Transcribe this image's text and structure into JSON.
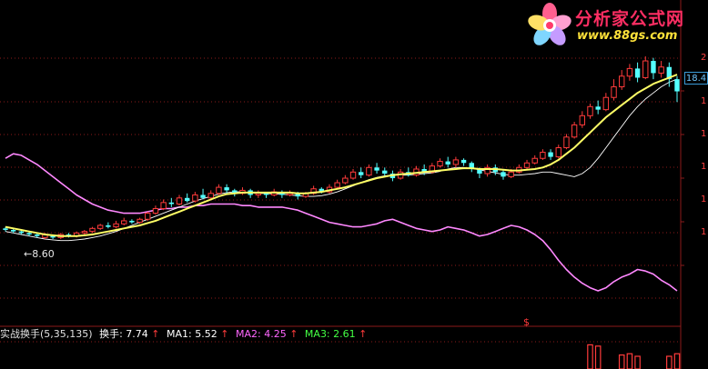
{
  "watermark": {
    "title": "分析家公式网",
    "url": "www.88gs.com"
  },
  "indicator": {
    "name": "实战换手(5,35,135)",
    "turnover_label": "换手:",
    "turnover_value": "7.74",
    "ma1_label": "MA1:",
    "ma1_value": "5.52",
    "ma2_label": "MA2:",
    "ma2_value": "4.25",
    "ma3_label": "MA3:",
    "ma3_value": "2.61",
    "arrow": "↑"
  },
  "price_tag": "18.4",
  "low_marker": "←8.60",
  "signal_marker": "$",
  "right_axis_ticks": [
    "2",
    "1",
    "1",
    "1",
    "1",
    "1"
  ],
  "colors": {
    "background": "#000000",
    "grid": "#8b1a1a",
    "up_candle": "#ff3b3b",
    "down_candle": "#54ffff",
    "ma_short": "#ffffff",
    "ma_mid": "#ffff66",
    "ma_pink": "#ff88ff",
    "ma2_text": "#ff66ff",
    "ma3_text": "#44ff44",
    "volume": "#ff3b3b"
  },
  "chart_data": {
    "type": "candlestick",
    "low_price": 8.6,
    "last_price_label": 18.4,
    "candles": [
      [
        9.6,
        9.5,
        9.7,
        9.4
      ],
      [
        9.5,
        9.4,
        9.6,
        9.3
      ],
      [
        9.4,
        9.3,
        9.5,
        9.2
      ],
      [
        9.3,
        9.2,
        9.4,
        9.1
      ],
      [
        9.2,
        9.1,
        9.3,
        9.0
      ],
      [
        9.0,
        9.2,
        9.3,
        8.9
      ],
      [
        9.1,
        9.0,
        9.2,
        8.9
      ],
      [
        9.0,
        9.2,
        9.3,
        8.9
      ],
      [
        9.2,
        9.1,
        9.3,
        9.0
      ],
      [
        9.1,
        9.3,
        9.4,
        9.0
      ],
      [
        9.3,
        9.4,
        9.5,
        9.2
      ],
      [
        9.4,
        9.6,
        9.7,
        9.3
      ],
      [
        9.6,
        9.8,
        9.9,
        9.5
      ],
      [
        9.8,
        9.7,
        10.0,
        9.6
      ],
      [
        9.7,
        9.9,
        10.1,
        9.6
      ],
      [
        9.9,
        10.1,
        10.3,
        9.8
      ],
      [
        10.1,
        10.0,
        10.2,
        9.9
      ],
      [
        10.0,
        10.2,
        10.3,
        9.9
      ],
      [
        10.2,
        10.6,
        10.7,
        10.1
      ],
      [
        10.6,
        10.9,
        11.1,
        10.5
      ],
      [
        10.9,
        11.3,
        11.5,
        10.8
      ],
      [
        11.3,
        11.2,
        11.6,
        11.0
      ],
      [
        11.2,
        11.6,
        11.8,
        11.1
      ],
      [
        11.6,
        11.4,
        11.9,
        11.3
      ],
      [
        11.4,
        11.8,
        12.0,
        11.3
      ],
      [
        11.8,
        11.6,
        12.2,
        11.5
      ],
      [
        11.6,
        11.9,
        12.1,
        11.5
      ],
      [
        11.9,
        12.3,
        12.5,
        11.8
      ],
      [
        12.3,
        12.1,
        12.5,
        11.9
      ],
      [
        12.1,
        11.9,
        12.2,
        11.7
      ],
      [
        11.9,
        12.1,
        12.3,
        11.8
      ],
      [
        12.1,
        11.8,
        12.2,
        11.6
      ],
      [
        11.8,
        11.9,
        12.1,
        11.6
      ],
      [
        11.9,
        11.8,
        12.0,
        11.6
      ],
      [
        11.8,
        12.0,
        12.2,
        11.7
      ],
      [
        12.0,
        11.8,
        12.1,
        11.6
      ],
      [
        11.8,
        11.9,
        12.1,
        11.7
      ],
      [
        11.9,
        11.7,
        12.0,
        11.5
      ],
      [
        11.7,
        11.9,
        12.0,
        11.6
      ],
      [
        11.9,
        12.2,
        12.4,
        11.8
      ],
      [
        12.2,
        12.0,
        12.3,
        11.9
      ],
      [
        12.0,
        12.3,
        12.5,
        11.9
      ],
      [
        12.3,
        12.6,
        12.8,
        12.2
      ],
      [
        12.6,
        12.9,
        13.1,
        12.5
      ],
      [
        12.9,
        13.3,
        13.5,
        12.8
      ],
      [
        13.3,
        13.1,
        13.6,
        12.9
      ],
      [
        13.1,
        13.6,
        13.8,
        13.0
      ],
      [
        13.6,
        13.4,
        13.9,
        13.2
      ],
      [
        13.4,
        13.2,
        13.6,
        13.0
      ],
      [
        13.2,
        12.9,
        13.4,
        12.7
      ],
      [
        12.9,
        13.3,
        13.5,
        12.8
      ],
      [
        13.3,
        13.1,
        13.6,
        13.0
      ],
      [
        13.1,
        13.5,
        13.7,
        13.0
      ],
      [
        13.5,
        13.3,
        13.8,
        13.1
      ],
      [
        13.3,
        13.7,
        13.9,
        13.2
      ],
      [
        13.7,
        14.0,
        14.2,
        13.6
      ],
      [
        14.0,
        13.8,
        14.3,
        13.6
      ],
      [
        13.8,
        14.1,
        14.3,
        13.6
      ],
      [
        14.1,
        13.9,
        14.2,
        13.7
      ],
      [
        13.9,
        13.5,
        14.0,
        13.3
      ],
      [
        13.5,
        13.2,
        13.6,
        12.9
      ],
      [
        13.2,
        13.6,
        13.8,
        13.0
      ],
      [
        13.6,
        13.3,
        13.8,
        13.1
      ],
      [
        13.3,
        13.0,
        13.5,
        12.8
      ],
      [
        13.0,
        13.3,
        13.5,
        12.9
      ],
      [
        13.3,
        13.6,
        13.8,
        13.2
      ],
      [
        13.6,
        13.9,
        14.1,
        13.5
      ],
      [
        13.9,
        14.2,
        14.4,
        13.8
      ],
      [
        14.2,
        14.6,
        14.8,
        14.1
      ],
      [
        14.6,
        14.3,
        14.8,
        14.1
      ],
      [
        14.3,
        14.9,
        15.1,
        14.2
      ],
      [
        14.9,
        15.6,
        15.8,
        14.8
      ],
      [
        15.6,
        16.4,
        16.6,
        15.5
      ],
      [
        16.4,
        17.0,
        17.3,
        16.2
      ],
      [
        17.0,
        17.6,
        17.8,
        16.8
      ],
      [
        17.6,
        17.4,
        18.0,
        17.1
      ],
      [
        17.4,
        18.2,
        18.5,
        17.3
      ],
      [
        18.2,
        18.9,
        19.4,
        18.0
      ],
      [
        18.9,
        19.6,
        20.0,
        18.7
      ],
      [
        19.6,
        20.1,
        20.4,
        19.3
      ],
      [
        20.1,
        19.5,
        20.5,
        19.2
      ],
      [
        19.5,
        20.6,
        20.9,
        19.4
      ],
      [
        20.6,
        19.8,
        20.8,
        19.4
      ],
      [
        19.8,
        20.2,
        20.6,
        19.5
      ],
      [
        20.2,
        19.4,
        20.5,
        18.9
      ],
      [
        19.4,
        18.6,
        19.6,
        17.9
      ]
    ],
    "pink_line": [
      14.2,
      14.5,
      14.4,
      14.1,
      13.8,
      13.4,
      13.0,
      12.6,
      12.2,
      11.8,
      11.5,
      11.2,
      11.0,
      10.8,
      10.7,
      10.6,
      10.6,
      10.6,
      10.7,
      10.8,
      10.9,
      10.9,
      11.0,
      11.0,
      11.1,
      11.1,
      11.2,
      11.2,
      11.2,
      11.2,
      11.1,
      11.1,
      11.0,
      11.0,
      11.0,
      11.0,
      10.9,
      10.8,
      10.6,
      10.4,
      10.2,
      10.0,
      9.9,
      9.8,
      9.7,
      9.7,
      9.8,
      9.9,
      10.1,
      10.2,
      10.0,
      9.8,
      9.6,
      9.5,
      9.4,
      9.5,
      9.7,
      9.6,
      9.5,
      9.3,
      9.1,
      9.2,
      9.4,
      9.6,
      9.8,
      9.7,
      9.5,
      9.2,
      8.8,
      8.2,
      7.5,
      6.9,
      6.4,
      6.0,
      5.7,
      5.5,
      5.7,
      6.1,
      6.4,
      6.6,
      6.9,
      6.8,
      6.6,
      6.2,
      5.9,
      5.5
    ],
    "yellow_line": [
      9.7,
      9.6,
      9.5,
      9.4,
      9.3,
      9.2,
      9.15,
      9.1,
      9.1,
      9.1,
      9.15,
      9.2,
      9.3,
      9.4,
      9.5,
      9.6,
      9.7,
      9.8,
      9.95,
      10.1,
      10.3,
      10.5,
      10.7,
      10.9,
      11.1,
      11.3,
      11.5,
      11.7,
      11.85,
      11.9,
      11.95,
      11.95,
      11.95,
      11.95,
      11.95,
      11.95,
      11.95,
      11.9,
      11.9,
      11.95,
      12.0,
      12.1,
      12.2,
      12.3,
      12.45,
      12.6,
      12.75,
      12.9,
      13.0,
      13.1,
      13.15,
      13.2,
      13.25,
      13.3,
      13.35,
      13.4,
      13.45,
      13.5,
      13.55,
      13.55,
      13.5,
      13.5,
      13.5,
      13.45,
      13.4,
      13.4,
      13.45,
      13.5,
      13.6,
      13.8,
      14.1,
      14.5,
      14.9,
      15.4,
      15.9,
      16.4,
      16.9,
      17.3,
      17.7,
      18.1,
      18.5,
      18.8,
      19.1,
      19.3,
      19.5,
      19.7
    ],
    "white_line": [
      9.4,
      9.3,
      9.2,
      9.1,
      9.0,
      8.9,
      8.85,
      8.8,
      8.8,
      8.85,
      8.9,
      9.0,
      9.1,
      9.25,
      9.4,
      9.6,
      9.8,
      10.0,
      10.2,
      10.4,
      10.6,
      10.8,
      11.0,
      11.2,
      11.4,
      11.55,
      11.7,
      11.85,
      11.95,
      12.0,
      12.0,
      11.95,
      11.9,
      11.9,
      11.85,
      11.85,
      11.8,
      11.75,
      11.7,
      11.7,
      11.75,
      11.85,
      12.0,
      12.2,
      12.4,
      12.6,
      12.8,
      12.95,
      13.05,
      13.1,
      13.1,
      13.1,
      13.15,
      13.2,
      13.25,
      13.35,
      13.5,
      13.6,
      13.6,
      13.55,
      13.45,
      13.35,
      13.25,
      13.15,
      13.1,
      13.1,
      13.15,
      13.2,
      13.3,
      13.3,
      13.2,
      13.1,
      13.0,
      13.2,
      13.6,
      14.2,
      14.9,
      15.6,
      16.3,
      17.0,
      17.6,
      18.1,
      18.5,
      18.9,
      19.2,
      19.4
    ],
    "volume": [
      {
        "index": 74,
        "value": 0.95
      },
      {
        "index": 75,
        "value": 0.9
      },
      {
        "index": 78,
        "value": 0.55
      },
      {
        "index": 79,
        "value": 0.6
      },
      {
        "index": 80,
        "value": 0.5
      },
      {
        "index": 84,
        "value": 0.5
      },
      {
        "index": 85,
        "value": 0.6
      }
    ],
    "signal_index": 66
  }
}
